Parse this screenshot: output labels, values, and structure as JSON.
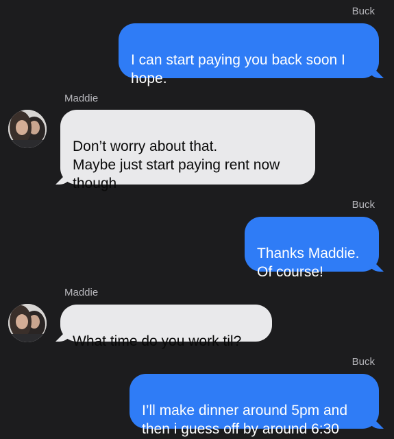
{
  "messages": [
    {
      "sender": "Buck",
      "direction": "outgoing",
      "text": "I can start paying you back soon I\nhope."
    },
    {
      "sender": "Maddie",
      "direction": "incoming",
      "text": "Don’t worry about that.\nMaybe just start paying rent now\nthough"
    },
    {
      "sender": "Buck",
      "direction": "outgoing",
      "text": "Thanks Maddie.\nOf course!"
    },
    {
      "sender": "Maddie",
      "direction": "incoming",
      "text": "What time do you work til?"
    },
    {
      "sender": "Buck",
      "direction": "outgoing",
      "text": "I’ll make dinner around 5pm and\nthen i guess off by around 6:30"
    }
  ],
  "colors": {
    "background": "#1c1c1e",
    "outgoing_bubble": "#2f7cf6",
    "incoming_bubble": "#e9e9eb",
    "sender_label": "#b5b5ba"
  },
  "icons": {
    "contact_avatar": "maddie-avatar-photo"
  }
}
